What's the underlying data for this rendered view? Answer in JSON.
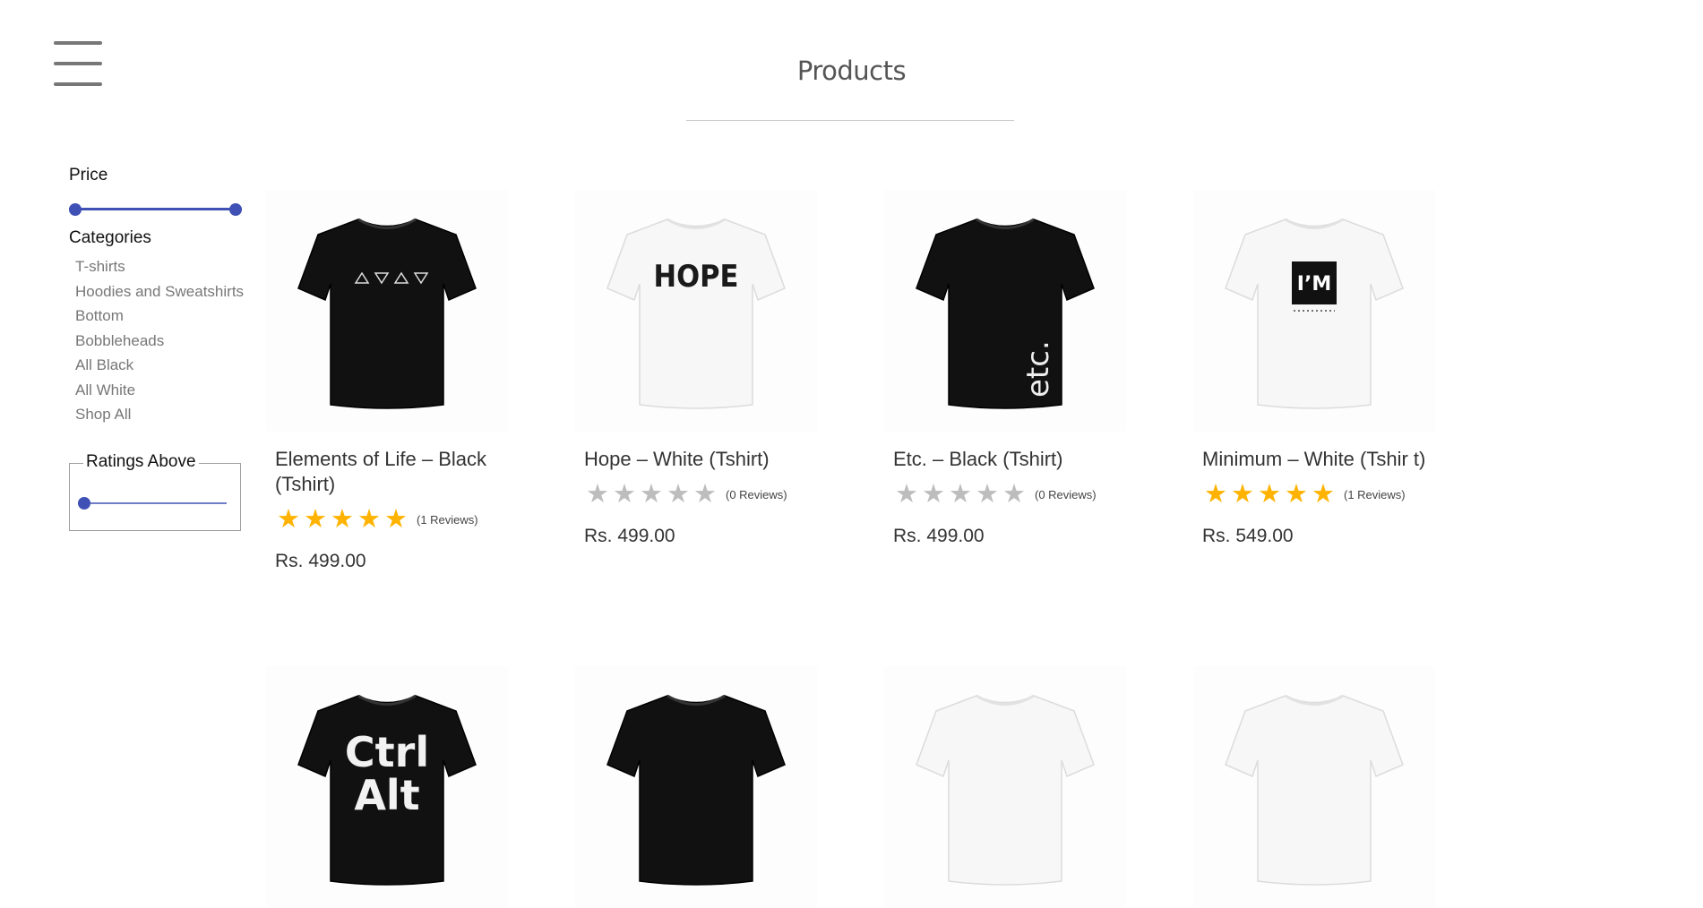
{
  "header": {
    "title": "Products",
    "menu_icon": "hamburger-menu-icon"
  },
  "filters": {
    "price_label": "Price",
    "price_range": {
      "low": 0,
      "high": 1
    },
    "categories_label": "Categories",
    "categories": [
      "T-shirts",
      "Hoodies and Sweatshirts",
      "Bottom",
      "Bobbleheads",
      "All Black",
      "All White",
      "Shop All"
    ],
    "ratings_label": "Ratings Above",
    "ratings_value": 0
  },
  "colors": {
    "accent": "#3f51b5",
    "star_filled": "#ffb300",
    "star_empty": "#bdbdbd"
  },
  "products": [
    {
      "name": "Elements of Life – Black (Tshirt)",
      "rating": 5,
      "reviews": "(1 Reviews)",
      "price": "Rs. 499.00",
      "shirt_color": "#111111",
      "print": "elements-triangles"
    },
    {
      "name": "Hope – White (Tshirt)",
      "rating": 0,
      "reviews": "(0 Reviews)",
      "price": "Rs. 499.00",
      "shirt_color": "#f7f7f7",
      "print": "hope-text",
      "print_text": "HOPE"
    },
    {
      "name": "Etc. – Black (Tshirt)",
      "rating": 0,
      "reviews": "(0 Reviews)",
      "price": "Rs. 499.00",
      "shirt_color": "#111111",
      "print": "etc-vertical-text",
      "print_text": "etc."
    },
    {
      "name": "Minimum – White (Tshir t)",
      "rating": 5,
      "reviews": "(1 Reviews)",
      "price": "Rs. 549.00",
      "shirt_color": "#f7f7f7",
      "print": "im-box",
      "print_text": "I’M"
    },
    {
      "shirt_color": "#111111",
      "print": "ctrl-text",
      "print_text": "Ctrl Alt"
    },
    {
      "shirt_color": "#111111",
      "print": "none"
    },
    {
      "shirt_color": "#f7f7f7",
      "print": "none"
    },
    {
      "shirt_color": "#f7f7f7",
      "print": "none"
    }
  ]
}
